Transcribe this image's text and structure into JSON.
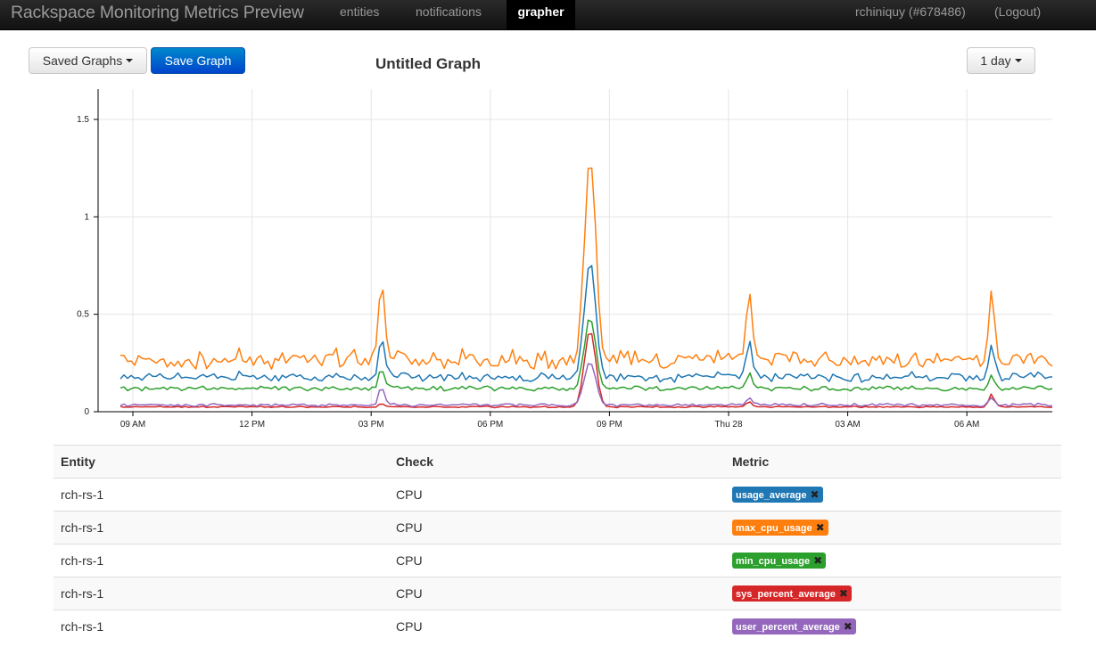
{
  "app": {
    "brand": "Rackspace Monitoring Metrics Preview",
    "nav": [
      {
        "label": "entities",
        "active": false
      },
      {
        "label": "notifications",
        "active": false
      },
      {
        "label": "grapher",
        "active": true
      }
    ],
    "user": "rchiniquy (#678486)",
    "logout": "(Logout)"
  },
  "toolbar": {
    "saved_graphs_label": "Saved Graphs",
    "save_graph_label": "Save Graph",
    "graph_title": "Untitled Graph",
    "range_label": "1 day"
  },
  "chart_data": {
    "type": "line",
    "title": "",
    "xlabel": "",
    "ylabel": "",
    "x_ticks": [
      "09 AM",
      "12 PM",
      "03 PM",
      "06 PM",
      "09 PM",
      "Thu 28",
      "03 AM",
      "06 AM"
    ],
    "y_ticks": [
      "0",
      "0.5",
      "1",
      "1.5"
    ],
    "ylim": [
      0,
      1.5
    ],
    "grid": true,
    "series": [
      {
        "name": "usage_average",
        "color": "#1f77b4",
        "baseline": 0.18,
        "noise": 0.025,
        "spikes": [
          [
            0.28,
            0.38
          ],
          [
            0.504,
            0.78
          ],
          [
            0.675,
            0.35
          ],
          [
            0.935,
            0.34
          ]
        ]
      },
      {
        "name": "max_cpu_usage",
        "color": "#ff7f0e",
        "baseline": 0.27,
        "noise": 0.05,
        "spikes": [
          [
            0.28,
            0.7
          ],
          [
            0.504,
            1.31
          ],
          [
            0.675,
            0.59
          ],
          [
            0.935,
            0.63
          ]
        ]
      },
      {
        "name": "min_cpu_usage",
        "color": "#2ca02c",
        "baseline": 0.12,
        "noise": 0.012,
        "spikes": [
          [
            0.28,
            0.22
          ],
          [
            0.504,
            0.49
          ],
          [
            0.675,
            0.19
          ],
          [
            0.935,
            0.18
          ]
        ]
      },
      {
        "name": "sys_percent_average",
        "color": "#d62728",
        "baseline": 0.025,
        "noise": 0.004,
        "spikes": [
          [
            0.28,
            0.04
          ],
          [
            0.504,
            0.42
          ],
          [
            0.675,
            0.05
          ],
          [
            0.935,
            0.09
          ]
        ]
      },
      {
        "name": "user_percent_average",
        "color": "#9467bd",
        "baseline": 0.035,
        "noise": 0.008,
        "spikes": [
          [
            0.28,
            0.13
          ],
          [
            0.504,
            0.26
          ],
          [
            0.675,
            0.07
          ],
          [
            0.935,
            0.07
          ]
        ]
      }
    ]
  },
  "table": {
    "headers": {
      "entity": "Entity",
      "check": "Check",
      "metric": "Metric"
    },
    "rows": [
      {
        "entity": "rch-rs-1",
        "check": "CPU",
        "metric": "usage_average",
        "color": "#1f77b4"
      },
      {
        "entity": "rch-rs-1",
        "check": "CPU",
        "metric": "max_cpu_usage",
        "color": "#ff7f0e"
      },
      {
        "entity": "rch-rs-1",
        "check": "CPU",
        "metric": "min_cpu_usage",
        "color": "#2ca02c"
      },
      {
        "entity": "rch-rs-1",
        "check": "CPU",
        "metric": "sys_percent_average",
        "color": "#d62728"
      },
      {
        "entity": "rch-rs-1",
        "check": "CPU",
        "metric": "user_percent_average",
        "color": "#9467bd"
      }
    ],
    "remove_icon": "close-icon"
  }
}
